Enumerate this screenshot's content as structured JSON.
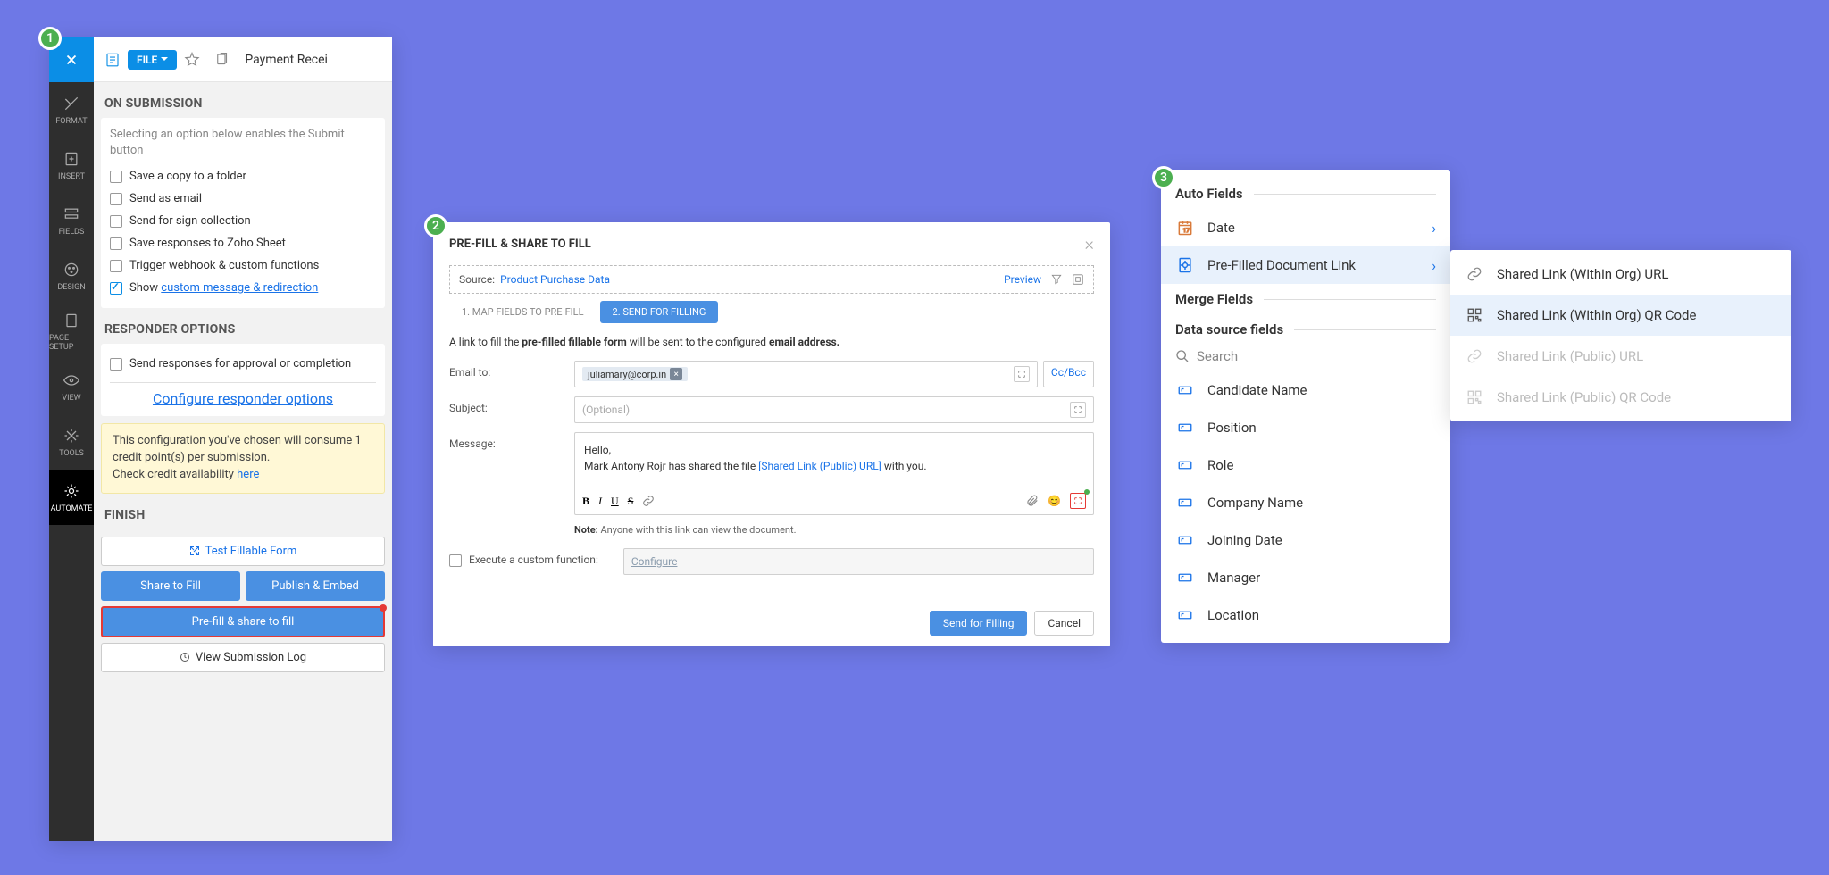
{
  "topbar": {
    "file": "FILE",
    "title": "Payment Recei"
  },
  "rail": [
    {
      "label": "FORMAT"
    },
    {
      "label": "INSERT"
    },
    {
      "label": "FIELDS"
    },
    {
      "label": "DESIGN"
    },
    {
      "label": "PAGE SETUP"
    },
    {
      "label": "VIEW"
    },
    {
      "label": "TOOLS"
    },
    {
      "label": "AUTOMATE"
    }
  ],
  "section1": {
    "title": "ON SUBMISSION",
    "helper": "Selecting an option below enables the Submit button",
    "opts": [
      "Save a copy to a folder",
      "Send as email",
      "Send for sign collection",
      "Save responses to Zoho Sheet",
      "Trigger webhook & custom functions"
    ],
    "show": "Show ",
    "show_link": "custom message & redirection"
  },
  "section2": {
    "title": "RESPONDER OPTIONS",
    "opt1": "Send responses for approval or completion",
    "link": "Configure responder options"
  },
  "yellow": {
    "line1": "This configuration you've chosen will consume 1 credit point(s) per submission.",
    "line2": "Check credit availability ",
    "here": "here"
  },
  "finish": {
    "title": "FINISH",
    "test": "Test Fillable Form",
    "share": "Share to Fill",
    "publish": "Publish & Embed",
    "prefill": "Pre-fill & share to fill",
    "log": "View Submission Log"
  },
  "modal": {
    "title": "PRE-FILL & SHARE TO FILL",
    "source_lbl": "Source:",
    "source_val": "Product Purchase Data",
    "preview": "Preview",
    "tab1": "1. MAP FIELDS TO PRE-FILL",
    "tab2": "2. SEND FOR FILLING",
    "desc1": "A link to fill the ",
    "desc2": "pre-filled fillable form",
    "desc3": " will be sent to the configured ",
    "desc4": "email address.",
    "email_lbl": "Email to:",
    "email_chip": "juliamary@corp.in",
    "ccbcc": "Cc/Bcc",
    "subject_lbl": "Subject:",
    "subject_ph": "(Optional)",
    "message_lbl": "Message:",
    "msg_hello": "Hello,",
    "msg_line": "Mark Antony Rojr has shared the file ",
    "msg_link": "[Shared Link (Public) URL]",
    "msg_end": " with you.",
    "note_lbl": "Note:",
    "note_txt": " Anyone with this link can view the document.",
    "exec_lbl": "Execute a custom function:",
    "configure": "Configure",
    "send": "Send for Filling",
    "cancel": "Cancel"
  },
  "panel3": {
    "autofields": "Auto Fields",
    "date": "Date",
    "prefilled": "Pre-Filled Document Link",
    "mergefields": "Merge Fields",
    "datasource": "Data source fields",
    "search": "Search",
    "fields": [
      "Candidate Name",
      "Position",
      "Role",
      "Company Name",
      "Joining Date",
      "Manager",
      "Location"
    ]
  },
  "submenu": {
    "items": [
      "Shared Link (Within Org) URL",
      "Shared Link (Within Org) QR Code",
      "Shared Link (Public) URL",
      "Shared Link (Public) QR Code"
    ]
  }
}
